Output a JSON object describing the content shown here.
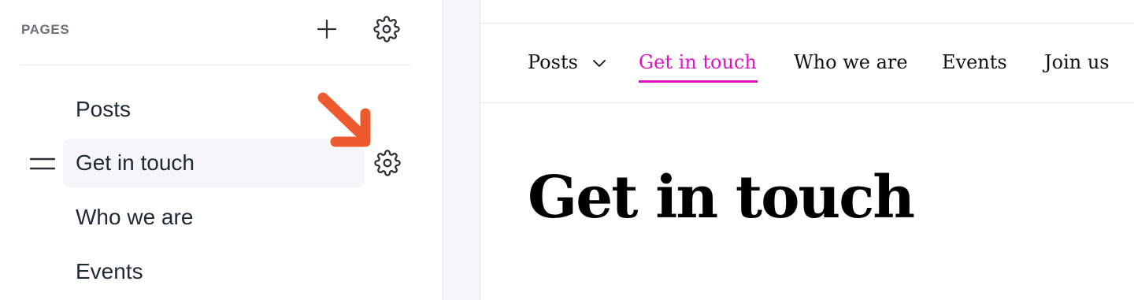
{
  "pages_panel": {
    "title": "PAGES",
    "add_icon": "plus-icon",
    "settings_icon": "gear-icon",
    "items": [
      {
        "label": "Posts",
        "active": false
      },
      {
        "label": "Get in touch",
        "active": true
      },
      {
        "label": "Who we are",
        "active": false
      },
      {
        "label": "Events",
        "active": false
      }
    ],
    "active_item_settings_icon": "gear-icon",
    "drag_handle_icon": "drag-handle-icon",
    "callout_icon": "arrow-callout-icon"
  },
  "preview": {
    "nav": [
      {
        "label": "Posts",
        "has_dropdown": true,
        "active": false
      },
      {
        "label": "Get in touch",
        "active": true
      },
      {
        "label": "Who we are",
        "active": false
      },
      {
        "label": "Events",
        "active": false
      },
      {
        "label": "Join us",
        "active": false
      }
    ],
    "heading": "Get in touch"
  },
  "colors": {
    "accent": "#e010c4",
    "callout_arrow": "#ee5a2f",
    "panel_label": "#6b7079",
    "text": "#1f2937"
  }
}
